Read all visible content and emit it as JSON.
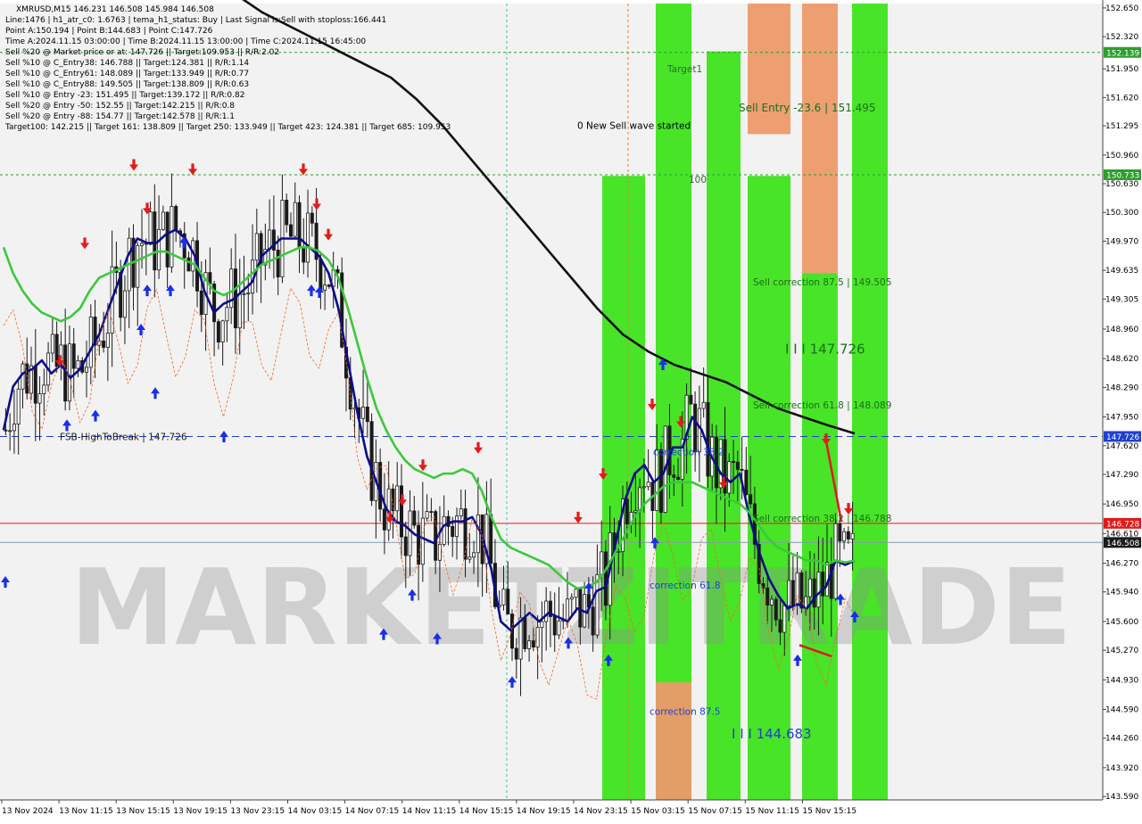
{
  "chart_data": {
    "type": "candlestick",
    "symbol": "XMRUSD,M15",
    "info_lines": [
      "XMRUSD,M15  146.231 146.508 145.984 146.508",
      "Line:1476 | h1_atr_c0: 1.6763 | tema_h1_status: Buy | Last Signal is:Sell with stoploss:166.441",
      "Point A:150.194 | Point B:144.683 | Point C:147.726",
      "Time A:2024.11.15 03:00:00 | Time B:2024.11.15 13:00:00 | Time C:2024.11.15 16:45:00",
      "Sell %20 @ Market price or at: 147.726 || Target:109.953 || R/R:2.02",
      "Sell %10 @ C_Entry38: 146.788 || Target:124.381 || R/R:1.14",
      "Sell %10 @ C_Entry61: 148.089 || Target:133.949 || R/R:0.77",
      "Sell %10 @ C_Entry88: 149.505 || Target:138.809 || R/R:0.63",
      "Sell %10 @ Entry -23: 151.495 || Target:139.172 || R/R:0.82",
      "Sell %20 @ Entry -50: 152.55 || Target:142.215 || R/R:0.8",
      "Sell %20 @ Entry -88: 154.77 || Target:142.578 || R/R:1.1",
      "Target100: 142.215 || Target 161: 138.809 || Target 250: 133.949 || Target 423: 124.381 || Target 685: 109.953"
    ],
    "y_ticks": [
      "152.650",
      "152.320",
      "151.950",
      "151.620",
      "151.295",
      "150.960",
      "150.630",
      "150.300",
      "149.970",
      "149.635",
      "149.305",
      "148.960",
      "148.620",
      "148.290",
      "147.950",
      "147.620",
      "147.290",
      "146.950",
      "146.610",
      "146.270",
      "145.940",
      "145.600",
      "145.270",
      "144.930",
      "144.590",
      "144.260",
      "143.920",
      "143.590"
    ],
    "ylim": [
      143.55,
      152.7
    ],
    "x_ticks": [
      "13 Nov 2024",
      "13 Nov 11:15",
      "13 Nov 15:15",
      "13 Nov 19:15",
      "13 Nov 23:15",
      "14 Nov 03:15",
      "14 Nov 07:15",
      "14 Nov 11:15",
      "14 Nov 15:15",
      "14 Nov 19:15",
      "14 Nov 23:15",
      "15 Nov 03:15",
      "15 Nov 07:15",
      "15 Nov 11:15",
      "15 Nov 15:15"
    ],
    "price_badges": [
      {
        "label": "152.139",
        "value": 152.139,
        "color": "#2e9e2e"
      },
      {
        "label": "150.733",
        "value": 150.733,
        "color": "#2e9e2e"
      },
      {
        "label": "147.726",
        "value": 147.726,
        "color": "#1f3fd1"
      },
      {
        "label": "146.728",
        "value": 146.728,
        "color": "#e01a1a"
      },
      {
        "label": "146.508",
        "value": 146.508,
        "color": "#1a1a1a"
      }
    ],
    "annotations": [
      {
        "text": "Target1",
        "value": 151.95,
        "color": "#2e6e2e",
        "anchor": "lime"
      },
      {
        "text": "0 New Sell wave started",
        "value": 151.3,
        "color": "#000000",
        "anchor": "wave"
      },
      {
        "text": "Sell Entry -23.6 | 151.495",
        "value": 151.5,
        "color": "#1a6e1a",
        "anchor": "zone"
      },
      {
        "text": "100",
        "value": 150.68,
        "color": "#2e6e2e",
        "anchor": "lime"
      },
      {
        "text": "Sell correction 87.5 | 149.505",
        "value": 149.505,
        "color": "#1a6e1a",
        "anchor": "zone"
      },
      {
        "text": "I I I 147.726",
        "value": 148.72,
        "color": "#1a6e1a",
        "anchor": "big"
      },
      {
        "text": "Sell correction 61.8 | 148.089",
        "value": 148.089,
        "color": "#1a6e1a",
        "anchor": "zone"
      },
      {
        "text": "correction 38.2",
        "value": 147.55,
        "color": "#1f3fd1",
        "anchor": "corr"
      },
      {
        "text": "Sell correction 38.2 | 146.788",
        "value": 146.788,
        "color": "#1a6e1a",
        "anchor": "zone"
      },
      {
        "text": "correction 61.8",
        "value": 146.02,
        "color": "#1f3fd1",
        "anchor": "corr"
      },
      {
        "text": "correction 87.5",
        "value": 144.57,
        "color": "#1f3fd1",
        "anchor": "corr"
      },
      {
        "text": "I I I 144.683",
        "value": 144.3,
        "color": "#1f3fd1",
        "anchor": "low"
      },
      {
        "text": "FSB-HighToBreak | 147.726",
        "value": 147.726,
        "color": "#1a1a1a",
        "anchor": "fsb"
      }
    ],
    "watermark": "MARKETZITRADE",
    "series": [
      {
        "name": "",
        "color": "#0c0c8a",
        "values": [
          147.8,
          148.3,
          148.45,
          148.5,
          148.6,
          148.45,
          148.55,
          148.4,
          148.5,
          148.7,
          148.9,
          149.2,
          149.5,
          149.8,
          150.0,
          149.95,
          149.95,
          150.05,
          150.1,
          150.0,
          149.8,
          149.4,
          149.15,
          149.25,
          149.3,
          149.4,
          149.5,
          149.8,
          149.9,
          150.0,
          150.0,
          150.0,
          149.9,
          149.8,
          149.6,
          149.2,
          148.6,
          148.0,
          147.5,
          147.2,
          146.9,
          146.75,
          146.7,
          146.6,
          146.55,
          146.5,
          146.7,
          146.75,
          146.75,
          146.8,
          146.6,
          146.2,
          145.6,
          145.5,
          145.6,
          145.7,
          145.6,
          145.7,
          145.65,
          145.6,
          145.75,
          145.7,
          145.95,
          146.0,
          146.5,
          147.0,
          147.3,
          147.4,
          147.2,
          147.3,
          147.6,
          147.6,
          147.95,
          147.8,
          147.5,
          147.3,
          147.2,
          147.3,
          146.8,
          146.4,
          146.1,
          145.9,
          145.75,
          145.8,
          145.75,
          145.9,
          146.0,
          146.3,
          146.25,
          146.3
        ]
      },
      {
        "name": "",
        "color": "#3cc83c",
        "values": [
          149.9,
          149.6,
          149.4,
          149.25,
          149.15,
          149.1,
          149.05,
          149.1,
          149.2,
          149.4,
          149.55,
          149.6,
          149.65,
          149.7,
          149.75,
          149.8,
          149.85,
          149.85,
          149.8,
          149.75,
          149.7,
          149.55,
          149.4,
          149.35,
          149.4,
          149.5,
          149.6,
          149.7,
          149.75,
          149.8,
          149.85,
          149.9,
          149.9,
          149.85,
          149.75,
          149.55,
          149.2,
          148.8,
          148.4,
          148.05,
          147.8,
          147.6,
          147.45,
          147.35,
          147.3,
          147.25,
          147.3,
          147.3,
          147.35,
          147.3,
          147.1,
          146.8,
          146.55,
          146.45,
          146.4,
          146.35,
          146.3,
          146.25,
          146.15,
          146.05,
          145.98,
          146.0,
          146.05,
          146.2,
          146.4,
          146.6,
          146.8,
          146.95,
          147.05,
          147.15,
          147.2,
          147.2,
          147.2,
          147.15,
          147.1,
          147.05,
          147.0,
          146.95,
          146.85,
          146.7,
          146.55,
          146.45,
          146.4,
          146.35,
          146.3,
          146.3,
          146.25,
          146.3,
          146.28,
          146.3
        ]
      },
      {
        "name": "",
        "color": "#111111",
        "values": [
          153.0,
          152.8,
          152.6,
          152.45,
          152.3,
          152.15,
          152.0,
          151.85,
          151.6,
          151.3,
          150.95,
          150.6,
          150.25,
          149.9,
          149.55,
          149.2,
          148.9,
          148.7,
          148.55,
          148.45,
          148.35,
          148.2,
          148.05,
          147.95,
          147.85,
          147.76
        ]
      }
    ]
  }
}
